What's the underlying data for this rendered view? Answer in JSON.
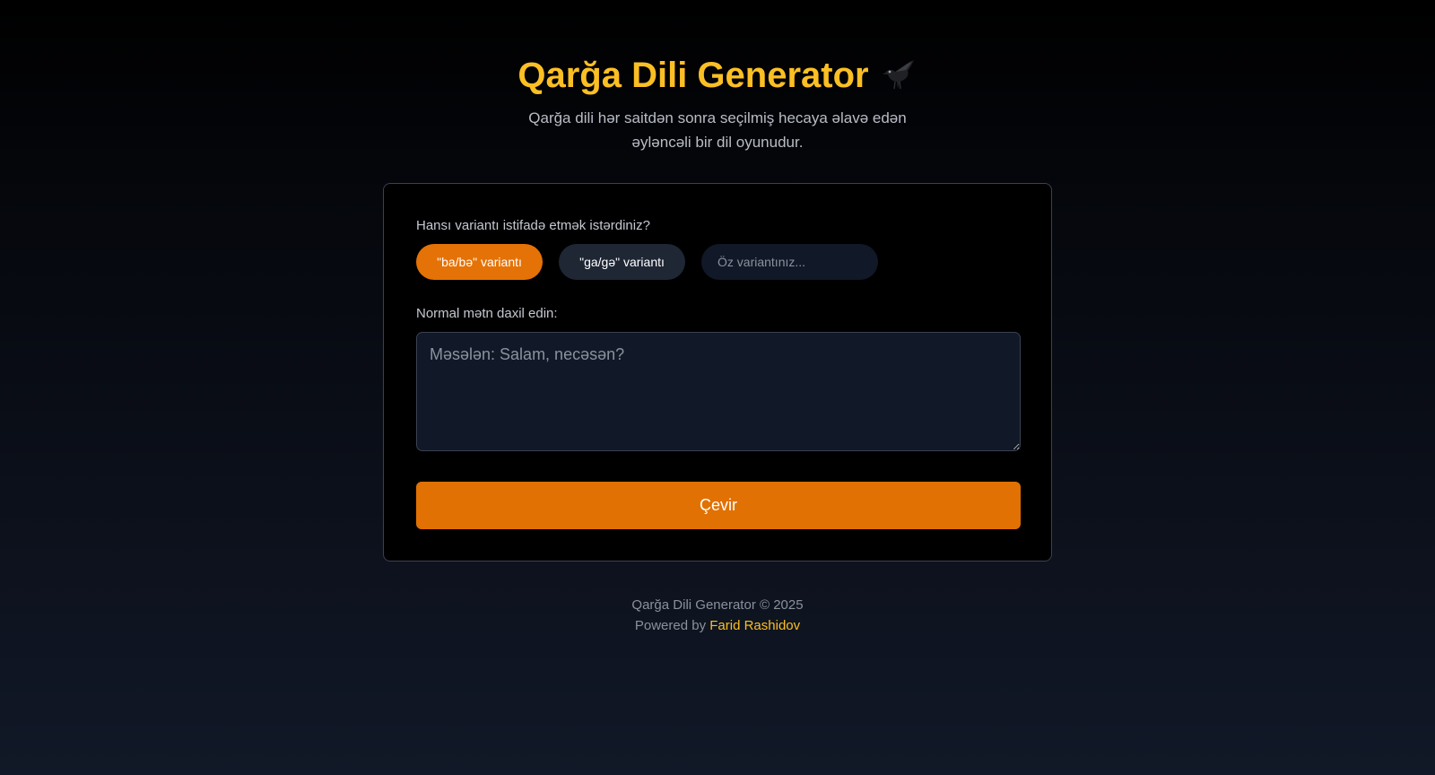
{
  "header": {
    "title": "Qarğa Dili Generator",
    "title_icon": "crow-icon",
    "subtitle": "Qarğa dili hər saitdən sonra seçilmiş hecaya əlavə edən əyləncəli bir dil oyunudur."
  },
  "form": {
    "variant_label": "Hansı variantı istifadə etmək istərdiniz?",
    "variants": [
      {
        "label": "\"ba/bə\" variantı",
        "selected": true
      },
      {
        "label": "\"ga/gə\" variantı",
        "selected": false
      }
    ],
    "custom_variant": {
      "placeholder": "Öz variantınız...",
      "value": ""
    },
    "text_label": "Normal mətn daxil edin:",
    "text_input": {
      "placeholder": "Məsələn: Salam, necəsən?",
      "value": ""
    },
    "submit_label": "Çevir"
  },
  "footer": {
    "copyright": "Qarğa Dili Generator © 2025",
    "powered_prefix": "Powered by",
    "author": "Farid Rashidov"
  },
  "colors": {
    "accent": "#fbbf24",
    "button": "#e17103",
    "card_background": "#000000",
    "input_background": "#111827"
  }
}
